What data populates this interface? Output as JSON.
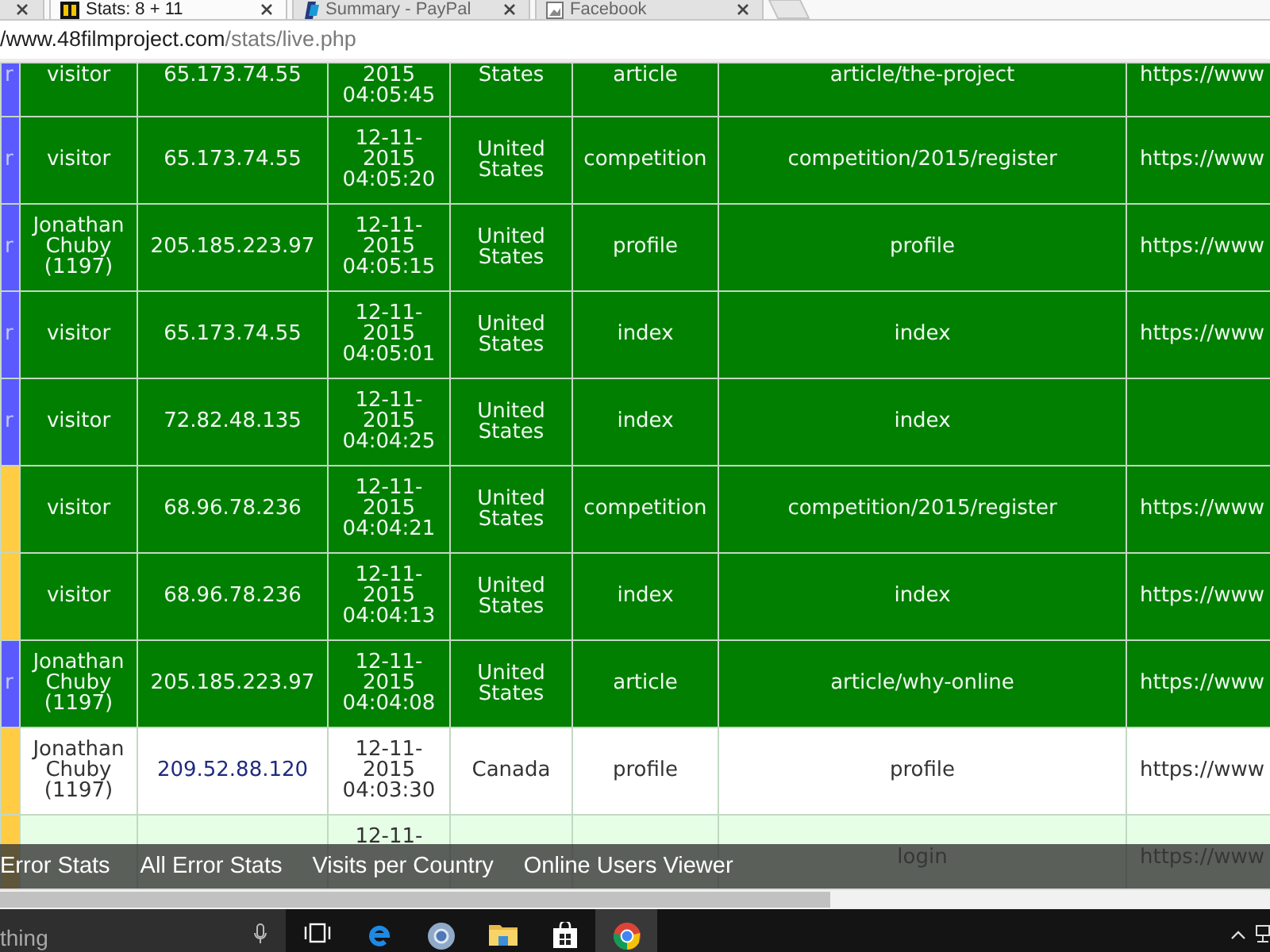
{
  "tabs": [
    {
      "selected": false
    },
    {
      "title": "Stats: 8 + 11",
      "selected": true
    },
    {
      "title": "Summary - PayPal",
      "selected": false
    },
    {
      "title": "Facebook",
      "selected": false
    }
  ],
  "address_bar": {
    "host": "/www.48filmproject.com",
    "path": "/stats/live.php"
  },
  "table": {
    "rows": [
      {
        "color": "#5a5aff",
        "column_0": "r",
        "kind": "highlight",
        "column_1": "visitor",
        "column_2": "65.173.74.55",
        "column_3": "2015 04:05:45",
        "column_4": "States",
        "column_5": "article",
        "column_6": "article/the-project",
        "column_7": "https://www"
      },
      {
        "color": "#5a5aff",
        "column_0": "r",
        "kind": "highlight",
        "column_1": "visitor",
        "column_2": "65.173.74.55",
        "column_3": "12-11-2015 04:05:20",
        "column_4": "United States",
        "column_5": "competition",
        "column_6": "competition/2015/register",
        "column_7": "https://www"
      },
      {
        "color": "#5a5aff",
        "column_0": "r",
        "kind": "highlight",
        "column_1": "Jonathan Chuby (1197)",
        "column_2": "205.185.223.97",
        "column_3": "12-11-2015 04:05:15",
        "column_4": "United States",
        "column_5": "profile",
        "column_6": "profile",
        "column_7": "https://www"
      },
      {
        "color": "#5a5aff",
        "column_0": "r",
        "kind": "highlight",
        "column_1": "visitor",
        "column_2": "65.173.74.55",
        "column_3": "12-11-2015 04:05:01",
        "column_4": "United States",
        "column_5": "index",
        "column_6": "index",
        "column_7": "https://www"
      },
      {
        "color": "#5a5aff",
        "column_0": "r",
        "kind": "highlight",
        "column_1": "visitor",
        "column_2": "72.82.48.135",
        "column_3": "12-11-2015 04:04:25",
        "column_4": "United States",
        "column_5": "index",
        "column_6": "index"
      },
      {
        "color": "#ffcc44",
        "kind": "highlight",
        "column_1": "visitor",
        "column_2": "68.96.78.236",
        "column_3": "12-11-2015 04:04:21",
        "column_4": "United States",
        "column_5": "competition",
        "column_6": "competition/2015/register",
        "column_7": "https://www"
      },
      {
        "color": "#ffcc44",
        "kind": "highlight",
        "column_1": "visitor",
        "column_2": "68.96.78.236",
        "column_3": "12-11-2015 04:04:13",
        "column_4": "United States",
        "column_5": "index",
        "column_6": "index",
        "column_7": "https://www"
      },
      {
        "color": "#5a5aff",
        "column_0": "r",
        "kind": "highlight",
        "column_1": "Jonathan Chuby (1197)",
        "column_2": "205.185.223.97",
        "column_3": "12-11-2015 04:04:08",
        "column_4": "United States",
        "column_5": "article",
        "column_6": "article/why-online",
        "column_7": "https://www"
      },
      {
        "color": "#ffcc44",
        "kind": "plain",
        "column_1": "Jonathan Chuby (1197)",
        "column_2": "209.52.88.120",
        "column_3": "12-11-2015 04:03:30",
        "column_4": "Canada",
        "column_5": "profile",
        "column_6": "profile",
        "column_7": "https://www"
      },
      {
        "color": "#ffcc44",
        "kind": "shaded",
        "column_3": "12-11-",
        "column_6": "login",
        "column_7": "https://www"
      }
    ]
  },
  "footer_links": [
    "Error Stats",
    "All Error Stats",
    "Visits per Country",
    "Online Users Viewer"
  ],
  "taskbar": {
    "search": {
      "placeholder": "thing"
    },
    "apps": [
      {
        "selected": false
      },
      {
        "selected": false
      },
      {
        "selected": false
      },
      {
        "selected": false
      },
      {
        "selected": false
      },
      {
        "selected": true
      }
    ]
  }
}
